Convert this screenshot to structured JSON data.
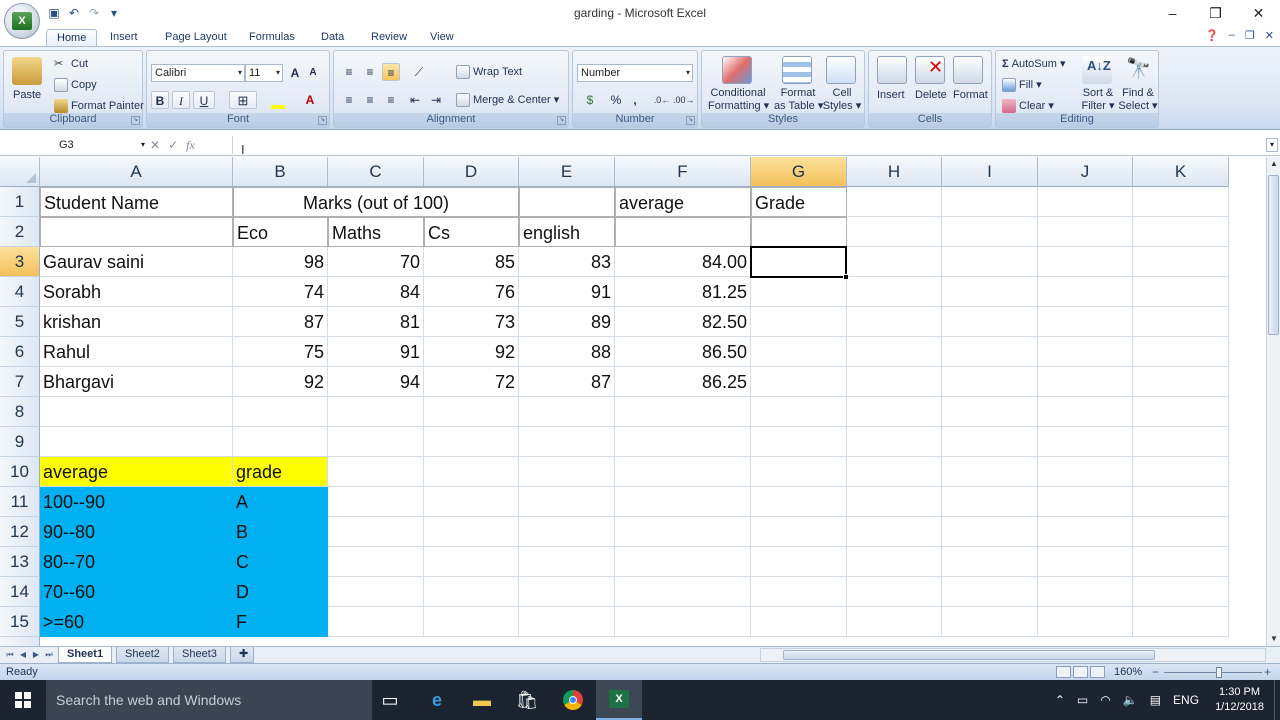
{
  "window": {
    "title": "garding - Microsoft Excel",
    "controls": [
      "–",
      "❐",
      "✕"
    ]
  },
  "quick_access": {
    "icons": [
      "save-icon",
      "undo-icon",
      "redo-icon",
      "customize-icon"
    ]
  },
  "tabs": [
    "Home",
    "Insert",
    "Page Layout",
    "Formulas",
    "Data",
    "Review",
    "View"
  ],
  "active_tab": "Home",
  "ribbon": {
    "clipboard": {
      "label": "Clipboard",
      "paste": "Paste",
      "cut": "Cut",
      "copy": "Copy",
      "format_painter": "Format Painter"
    },
    "font": {
      "label": "Font",
      "font_name": "Calibri",
      "font_size": "11",
      "bold": "B",
      "italic": "I",
      "underline": "U"
    },
    "alignment": {
      "label": "Alignment",
      "wrap_text": "Wrap Text",
      "merge_center": "Merge & Center"
    },
    "number": {
      "label": "Number",
      "format": "Number",
      "currency": "$",
      "percent": "%",
      "comma": ","
    },
    "styles": {
      "label": "Styles",
      "conditional": "Conditional",
      "conditional2": "Formatting",
      "format_as": "Format",
      "format_as2": "as Table",
      "cell": "Cell",
      "cell2": "Styles"
    },
    "cells": {
      "label": "Cells",
      "insert": "Insert",
      "delete": "Delete",
      "format": "Format"
    },
    "editing": {
      "label": "Editing",
      "autosum": "AutoSum",
      "fill": "Fill",
      "clear": "Clear",
      "sort": "Sort &",
      "sort2": "Filter",
      "find": "Find &",
      "find2": "Select"
    }
  },
  "formula_bar": {
    "name_box": "G3",
    "fx": "fx",
    "value": ""
  },
  "columns": [
    "A",
    "B",
    "C",
    "D",
    "E",
    "F",
    "G",
    "H",
    "I",
    "J",
    "K"
  ],
  "selected_column": "G",
  "selected_row": "3",
  "rows": [
    {
      "n": "1",
      "A": "Student Name",
      "C": "Marks (out of 100)",
      "F": "average",
      "G": "Grade"
    },
    {
      "n": "2",
      "B": "Eco",
      "C": "Maths",
      "D": "Cs",
      "E": "english"
    },
    {
      "n": "3",
      "A": "Gaurav saini",
      "B": "98",
      "C": "70",
      "D": "85",
      "E": "83",
      "F": "84.00"
    },
    {
      "n": "4",
      "A": "Sorabh",
      "B": "74",
      "C": "84",
      "D": "76",
      "E": "91",
      "F": "81.25"
    },
    {
      "n": "5",
      "A": "krishan",
      "B": "87",
      "C": "81",
      "D": "73",
      "E": "89",
      "F": "82.50"
    },
    {
      "n": "6",
      "A": "Rahul",
      "B": "75",
      "C": "91",
      "D": "92",
      "E": "88",
      "F": "86.50"
    },
    {
      "n": "7",
      "A": "Bhargavi",
      "B": "92",
      "C": "94",
      "D": "72",
      "E": "87",
      "F": "86.25"
    },
    {
      "n": "8"
    },
    {
      "n": "9"
    },
    {
      "n": "10",
      "A": "average",
      "B": "grade"
    },
    {
      "n": "11",
      "A": "100--90",
      "B": "A"
    },
    {
      "n": "12",
      "A": "90--80",
      "B": "B"
    },
    {
      "n": "13",
      "A": "80--70",
      "B": "C"
    },
    {
      "n": "14",
      "A": "70--60",
      "B": "D"
    },
    {
      "n": "15",
      "A": ">=60",
      "B": "F"
    }
  ],
  "sheets": [
    "Sheet1",
    "Sheet2",
    "Sheet3"
  ],
  "active_sheet": "Sheet1",
  "status": {
    "text": "Ready",
    "zoom": "160%"
  },
  "taskbar": {
    "search_placeholder": "Search the web and Windows",
    "language": "ENG",
    "time": "1:30 PM",
    "date": "1/12/2018"
  },
  "colors": {
    "yellow_fill": "#ffff00",
    "blue_fill": "#00b0f0",
    "selected_header": "#f5c05b"
  }
}
